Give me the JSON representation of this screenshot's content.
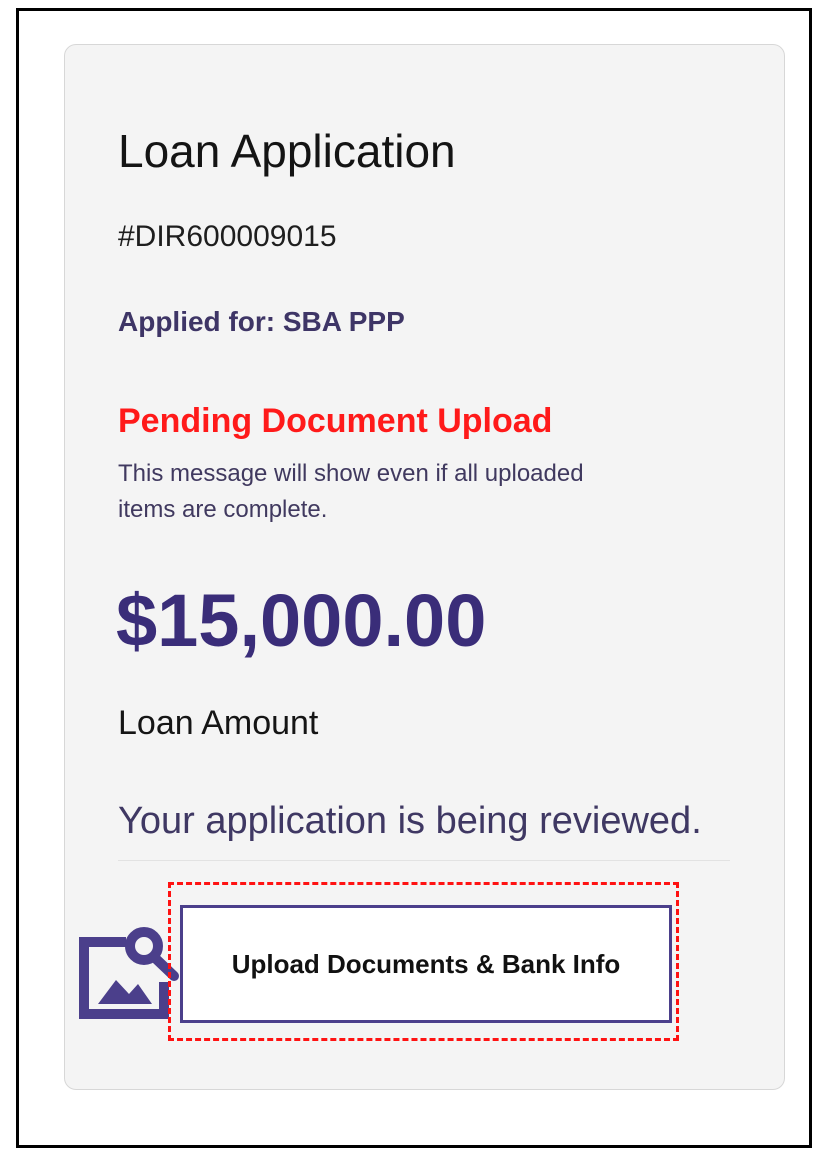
{
  "loan_card": {
    "title": "Loan Application",
    "application_id": "#DIR600009015",
    "applied_for": "Applied for: SBA PPP",
    "status_title": "Pending Document Upload",
    "status_note": "This message will show even if all uploaded items are complete.",
    "amount": "$15,000.00",
    "amount_label": "Loan Amount",
    "review_status": "Your application is being reviewed."
  },
  "actions": {
    "upload_button_label": "Upload Documents & Bank Info"
  },
  "icons": {
    "upload_icon": "image-search-icon"
  },
  "colors": {
    "accent": "#4b3f8b",
    "pending": "#ff1a1a",
    "card_background": "#f4f4f4",
    "highlight": "#ff1212"
  }
}
